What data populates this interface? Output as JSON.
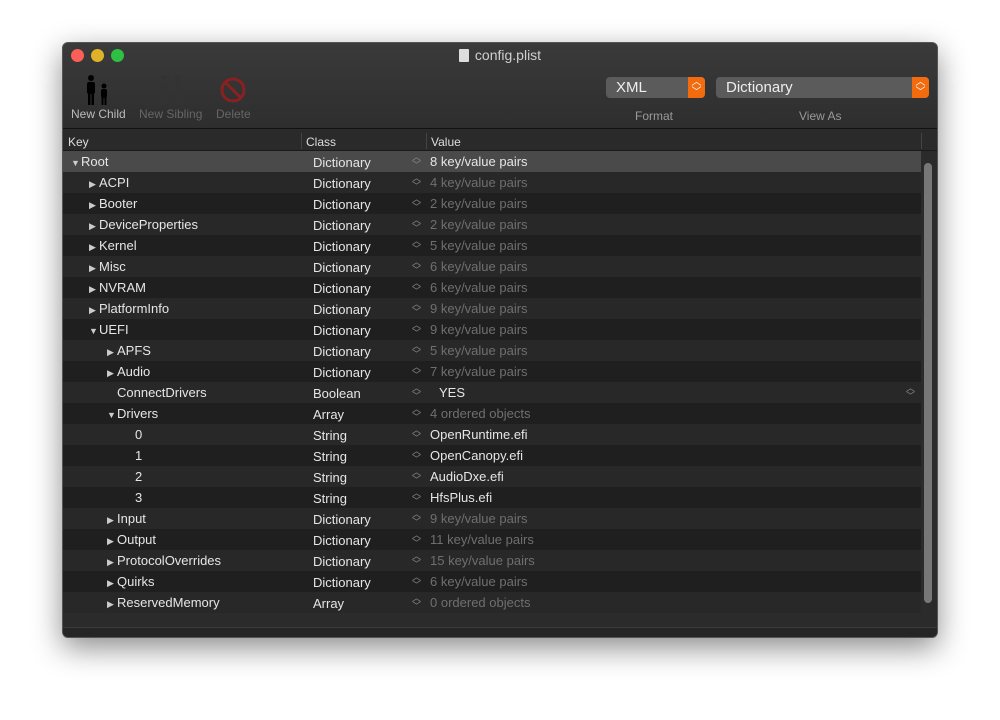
{
  "window": {
    "title": "config.plist"
  },
  "toolbar": {
    "new_child": "New Child",
    "new_sibling": "New Sibling",
    "delete": "Delete",
    "format_value": "XML",
    "format_label": "Format",
    "view_as_value": "Dictionary",
    "view_as_label": "View As",
    "accent": "#f26b0f"
  },
  "columns": {
    "key": "Key",
    "class": "Class",
    "value": "Value"
  },
  "rows": [
    {
      "key": "Root",
      "level": 0,
      "disclosure": "expanded",
      "class": "Dictionary",
      "value": "8 key/value pairs",
      "dim": false,
      "selected": true
    },
    {
      "key": "ACPI",
      "level": 1,
      "disclosure": "collapsed",
      "class": "Dictionary",
      "value": "4 key/value pairs",
      "dim": true
    },
    {
      "key": "Booter",
      "level": 1,
      "disclosure": "collapsed",
      "class": "Dictionary",
      "value": "2 key/value pairs",
      "dim": true
    },
    {
      "key": "DeviceProperties",
      "level": 1,
      "disclosure": "collapsed",
      "class": "Dictionary",
      "value": "2 key/value pairs",
      "dim": true
    },
    {
      "key": "Kernel",
      "level": 1,
      "disclosure": "collapsed",
      "class": "Dictionary",
      "value": "5 key/value pairs",
      "dim": true
    },
    {
      "key": "Misc",
      "level": 1,
      "disclosure": "collapsed",
      "class": "Dictionary",
      "value": "6 key/value pairs",
      "dim": true
    },
    {
      "key": "NVRAM",
      "level": 1,
      "disclosure": "collapsed",
      "class": "Dictionary",
      "value": "6 key/value pairs",
      "dim": true
    },
    {
      "key": "PlatformInfo",
      "level": 1,
      "disclosure": "collapsed",
      "class": "Dictionary",
      "value": "9 key/value pairs",
      "dim": true
    },
    {
      "key": "UEFI",
      "level": 1,
      "disclosure": "expanded",
      "class": "Dictionary",
      "value": "9 key/value pairs",
      "dim": true
    },
    {
      "key": "APFS",
      "level": 2,
      "disclosure": "collapsed",
      "class": "Dictionary",
      "value": "5 key/value pairs",
      "dim": true
    },
    {
      "key": "Audio",
      "level": 2,
      "disclosure": "collapsed",
      "class": "Dictionary",
      "value": "7 key/value pairs",
      "dim": true
    },
    {
      "key": "ConnectDrivers",
      "level": 2,
      "disclosure": "none",
      "class": "Boolean",
      "value": "YES",
      "dim": false,
      "popup": true
    },
    {
      "key": "Drivers",
      "level": 2,
      "disclosure": "expanded",
      "class": "Array",
      "value": "4 ordered objects",
      "dim": true
    },
    {
      "key": "0",
      "level": 3,
      "disclosure": "none",
      "class": "String",
      "value": "OpenRuntime.efi",
      "dim": false
    },
    {
      "key": "1",
      "level": 3,
      "disclosure": "none",
      "class": "String",
      "value": "OpenCanopy.efi",
      "dim": false
    },
    {
      "key": "2",
      "level": 3,
      "disclosure": "none",
      "class": "String",
      "value": "AudioDxe.efi",
      "dim": false
    },
    {
      "key": "3",
      "level": 3,
      "disclosure": "none",
      "class": "String",
      "value": "HfsPlus.efi",
      "dim": false
    },
    {
      "key": "Input",
      "level": 2,
      "disclosure": "collapsed",
      "class": "Dictionary",
      "value": "9 key/value pairs",
      "dim": true
    },
    {
      "key": "Output",
      "level": 2,
      "disclosure": "collapsed",
      "class": "Dictionary",
      "value": "11 key/value pairs",
      "dim": true
    },
    {
      "key": "ProtocolOverrides",
      "level": 2,
      "disclosure": "collapsed",
      "class": "Dictionary",
      "value": "15 key/value pairs",
      "dim": true
    },
    {
      "key": "Quirks",
      "level": 2,
      "disclosure": "collapsed",
      "class": "Dictionary",
      "value": "6 key/value pairs",
      "dim": true
    },
    {
      "key": "ReservedMemory",
      "level": 2,
      "disclosure": "collapsed",
      "class": "Array",
      "value": "0 ordered objects",
      "dim": true
    }
  ]
}
